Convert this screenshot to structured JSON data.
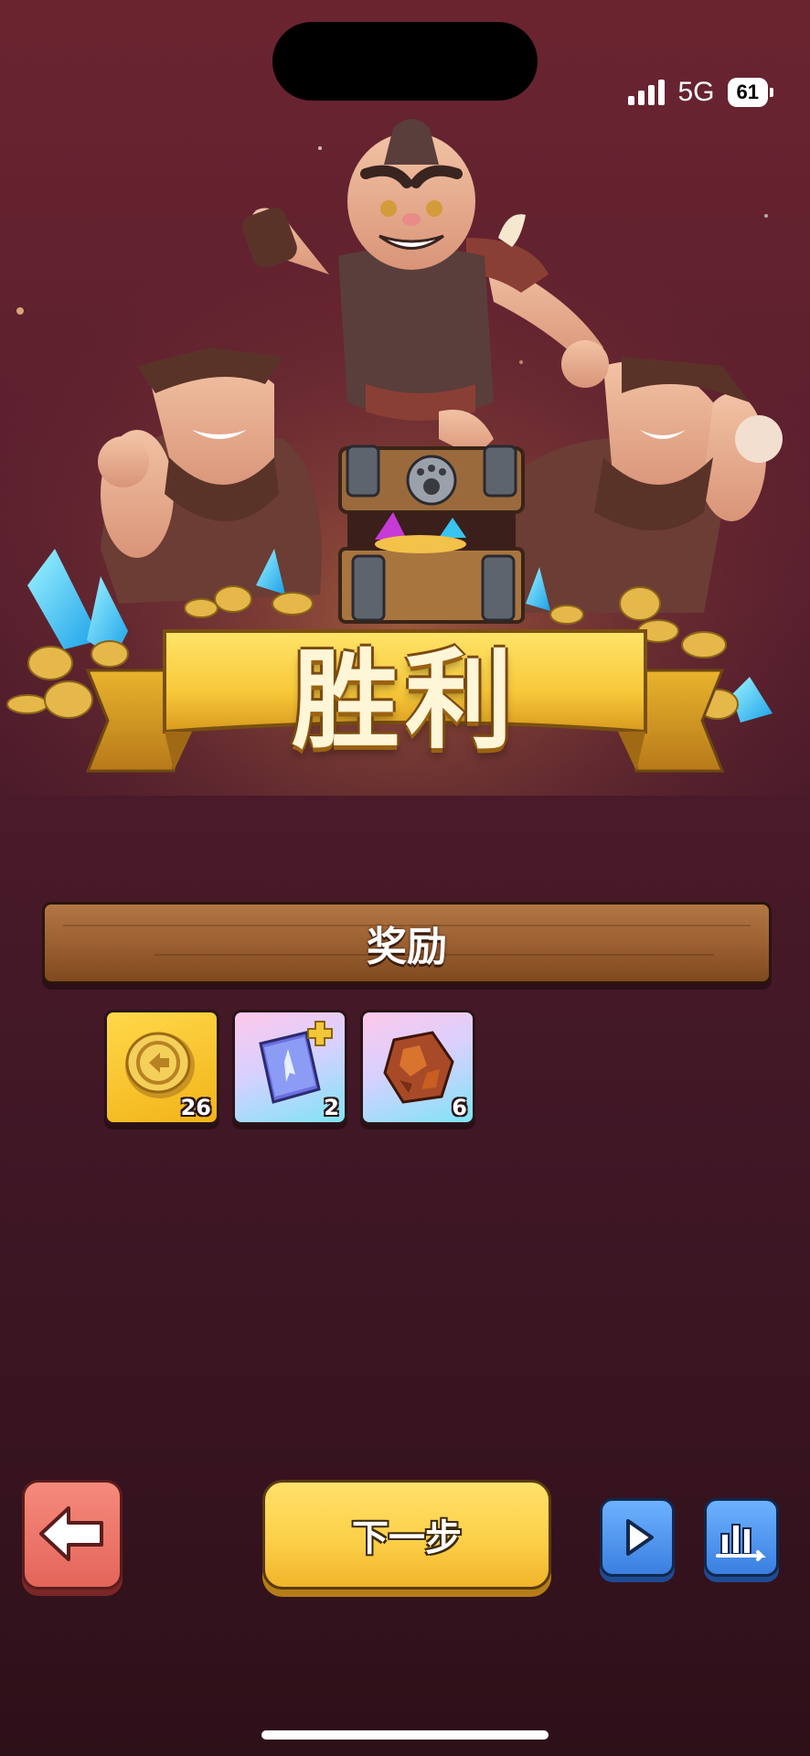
{
  "status_bar": {
    "network": "5G",
    "battery": "61"
  },
  "banner": {
    "title": "胜利"
  },
  "rewards_section": {
    "header": "奖励",
    "items": [
      {
        "icon": "gold-coin-icon",
        "count": "26"
      },
      {
        "icon": "rune-book-icon",
        "count": "2"
      },
      {
        "icon": "ore-stone-icon",
        "count": "6"
      }
    ]
  },
  "buttons": {
    "back_icon": "arrow-left-icon",
    "next_label": "下一步",
    "play_icon": "play-icon",
    "stats_icon": "bar-chart-icon"
  },
  "colors": {
    "background": "#4a1a2a",
    "gold_button": "#fcd049",
    "back_button": "#e4655a",
    "blue_button": "#3a7fe0",
    "plank": "#9c6132"
  }
}
